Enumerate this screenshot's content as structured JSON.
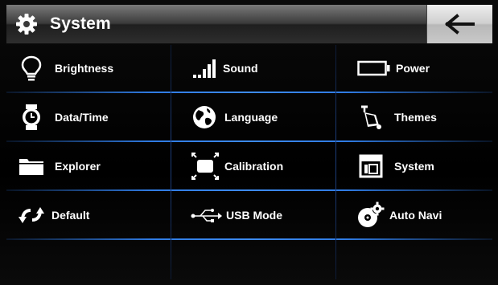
{
  "header": {
    "title": "System",
    "title_icon": "gear-icon",
    "back_icon": "arrow-left-icon"
  },
  "menu": {
    "items": [
      {
        "label": "Brightness",
        "icon": "lightbulb-icon"
      },
      {
        "label": "Sound",
        "icon": "volume-bars-icon"
      },
      {
        "label": "Power",
        "icon": "battery-icon"
      },
      {
        "label": "Data/Time",
        "icon": "watch-icon"
      },
      {
        "label": "Language",
        "icon": "globe-icon"
      },
      {
        "label": "Themes",
        "icon": "paint-bucket-icon"
      },
      {
        "label": "Explorer",
        "icon": "folder-icon"
      },
      {
        "label": "Calibration",
        "icon": "calibration-icon"
      },
      {
        "label": "System",
        "icon": "window-icon"
      },
      {
        "label": "Default",
        "icon": "reset-arrows-icon"
      },
      {
        "label": "USB Mode",
        "icon": "usb-icon"
      },
      {
        "label": "Auto Navi",
        "icon": "disc-gear-icon"
      }
    ]
  },
  "colors": {
    "accent_line": "#2f7be3",
    "background": "#000000",
    "text": "#ffffff"
  }
}
